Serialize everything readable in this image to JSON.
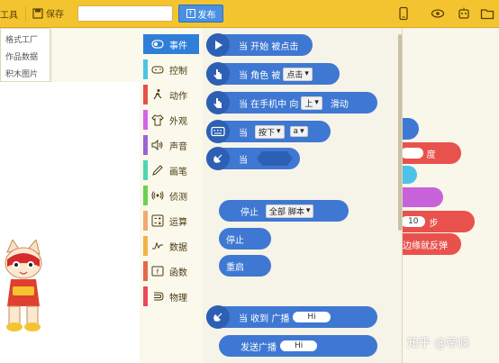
{
  "topbar": {
    "tools": "工具",
    "save": "保存",
    "publish": "发布",
    "title_value": ""
  },
  "menu": {
    "items": [
      "格式工厂",
      "作品数据",
      "积木图片"
    ]
  },
  "categories": [
    {
      "label": "事件",
      "color": "#2f7fd9",
      "icon": "toggle-icon"
    },
    {
      "label": "控制",
      "color": "#4dc3e8",
      "icon": "gamepad-icon"
    },
    {
      "label": "动作",
      "color": "#e3524a",
      "icon": "run-icon"
    },
    {
      "label": "外观",
      "color": "#d463e6",
      "icon": "shirt-icon"
    },
    {
      "label": "声音",
      "color": "#9b62d9",
      "icon": "speaker-icon"
    },
    {
      "label": "画笔",
      "color": "#4dd6b3",
      "icon": "pen-icon"
    },
    {
      "label": "侦测",
      "color": "#6ad24f",
      "icon": "radar-icon"
    },
    {
      "label": "运算",
      "color": "#f0a874",
      "icon": "calc-icon"
    },
    {
      "label": "数据",
      "color": "#f2b344",
      "icon": "data-icon"
    },
    {
      "label": "函数",
      "color": "#e36a49",
      "icon": "function-icon"
    },
    {
      "label": "物理",
      "color": "#e94a5a",
      "icon": "magnet-icon"
    }
  ],
  "blocks": {
    "start": "当 开始 被点击",
    "role_prefix": "当 角色 被",
    "role_dropdown": "点击",
    "phone_prefix": "当 在手机中 向",
    "phone_dropdown": "上",
    "phone_suffix": "滑动",
    "key_prefix": "当",
    "key_dropdown1": "按下",
    "key_dropdown2": "a",
    "when_prefix": "当",
    "stop_prefix": "停止",
    "stop_dropdown": "全部 脚本",
    "stop": "停止",
    "restart": "重启",
    "receive_prefix": "当 收到 广播",
    "receive_value": "Hi",
    "send_prefix": "发送广播",
    "send_value": "Hi"
  },
  "background_blocks": {
    "deg": "度",
    "num": "10",
    "step": "步",
    "bounce": "边缘就反弹"
  },
  "watermark": "知乎 @帝倏"
}
